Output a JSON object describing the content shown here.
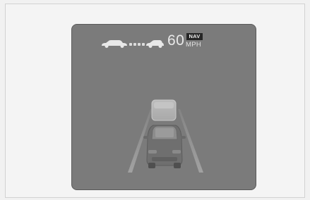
{
  "cluster": {
    "speed_value": "60",
    "nav_badge": "NAV",
    "speed_unit": "MPH",
    "icons": {
      "gap": "following-distance-icon",
      "lead_vehicle": "lead-vehicle-icon",
      "own_vehicle": "own-vehicle-icon",
      "lanes": "lane-lines-icon"
    }
  },
  "colors": {
    "page_bg": "#f1f1f1",
    "cluster_bg": "#7b7b7b",
    "text": "#e9e9e9",
    "badge_bg": "#262626"
  }
}
